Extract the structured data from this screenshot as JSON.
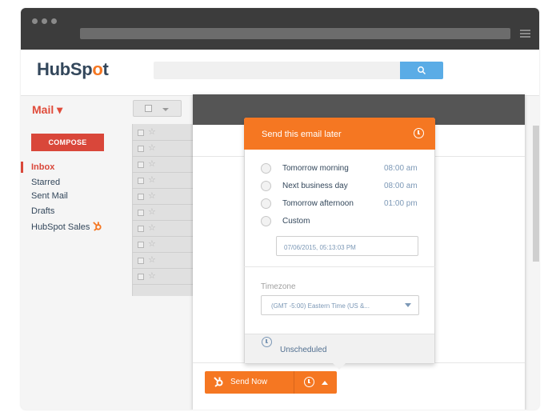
{
  "brand": {
    "logo_pre": "HubSp",
    "logo_o": "o",
    "logo_post": "t"
  },
  "sidebar": {
    "mail_label": "Mail ▾",
    "compose_label": "COMPOSE",
    "items": [
      {
        "label": "Inbox"
      },
      {
        "label": "Starred"
      },
      {
        "label": "Sent Mail"
      },
      {
        "label": "Drafts"
      },
      {
        "label": "HubSpot Sales"
      }
    ]
  },
  "popup": {
    "title": "Send this email later",
    "options": [
      {
        "label": "Tomorrow morning",
        "time": "08:00 am"
      },
      {
        "label": "Next business day",
        "time": "08:00 am"
      },
      {
        "label": "Tomorrow afternoon",
        "time": "01:00 pm"
      },
      {
        "label": "Custom",
        "time": ""
      }
    ],
    "custom_datetime": "07/06/2015, 05:13:03 PM",
    "timezone_label": "Timezone",
    "timezone_value": "(GMT -5:00) Eastern Time (US &...",
    "footer_label": "Unscheduled"
  },
  "composer": {
    "send_label": "Send Now"
  },
  "colors": {
    "accent": "#f57722",
    "compose": "#d9473a",
    "search": "#5aace6"
  }
}
